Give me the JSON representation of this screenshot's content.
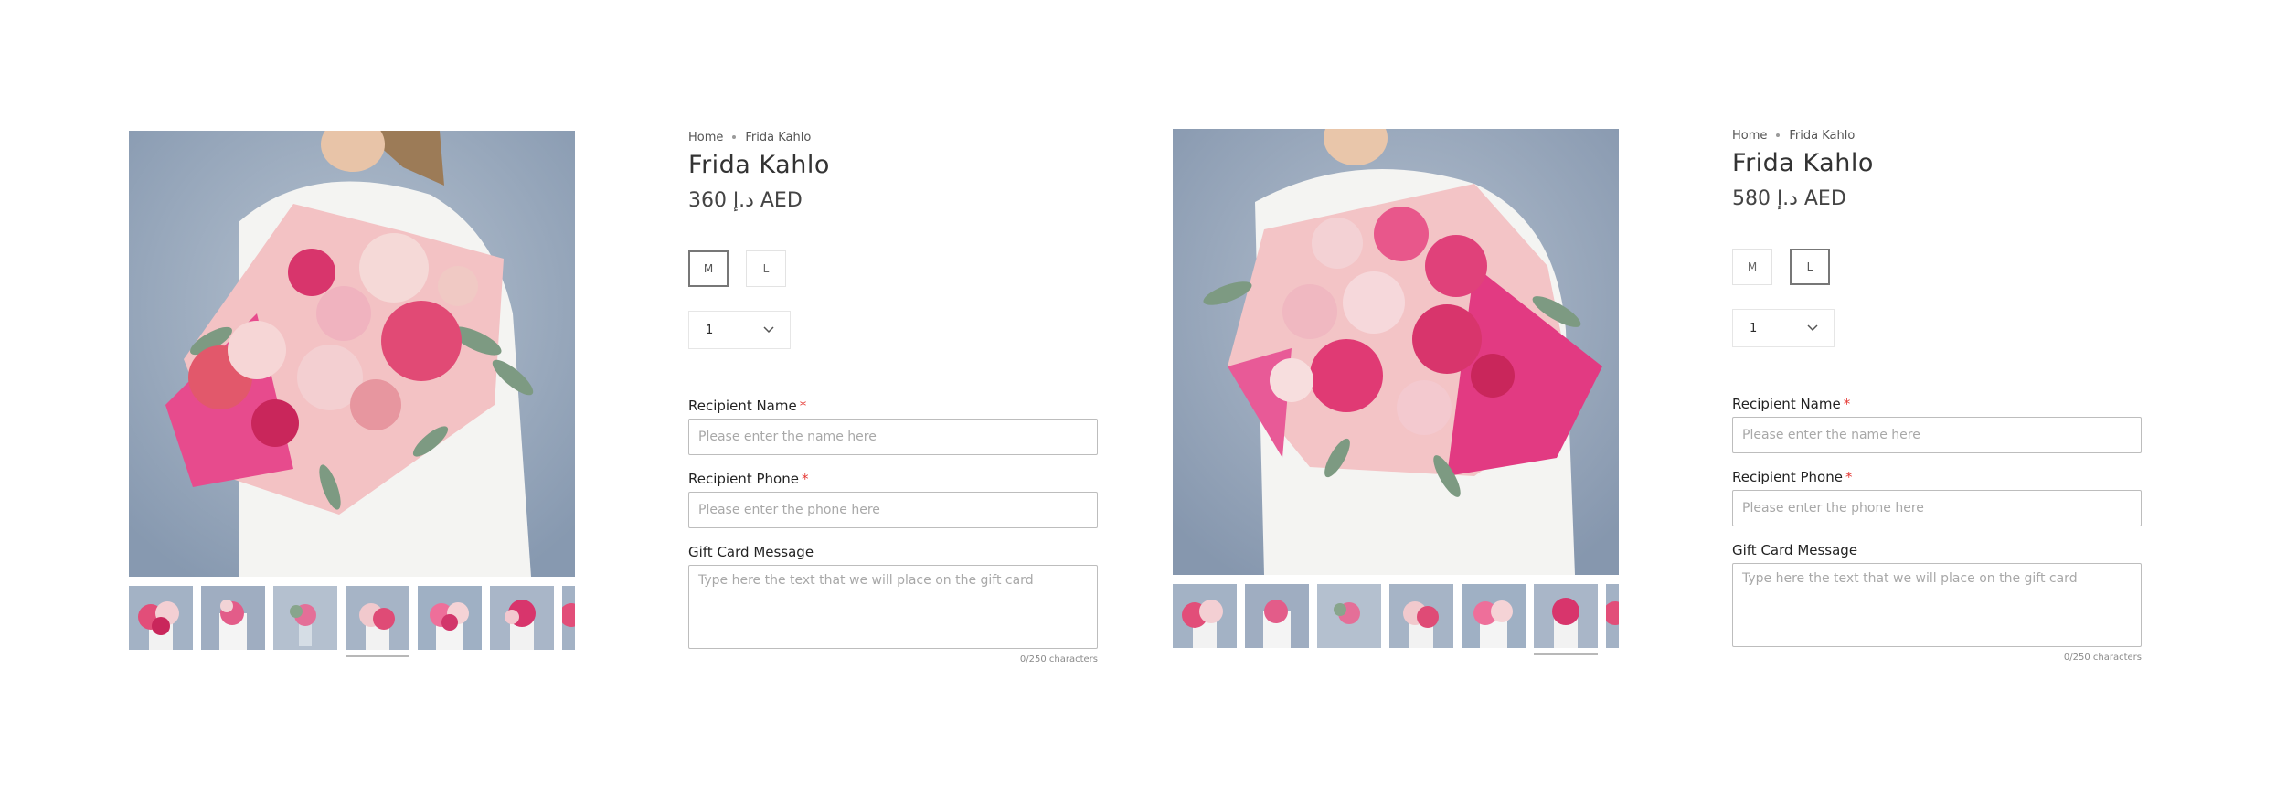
{
  "panels": [
    {
      "breadcrumb": {
        "home": "Home",
        "current": "Frida Kahlo"
      },
      "title": "Frida Kahlo",
      "price": "360 د.إ AED",
      "sizes": [
        {
          "label": "M",
          "selected": true
        },
        {
          "label": "L",
          "selected": false
        }
      ],
      "quantity": "1",
      "thumbnail_count": 7,
      "active_thumbnail": 4
    },
    {
      "breadcrumb": {
        "home": "Home",
        "current": "Frida Kahlo"
      },
      "title": "Frida Kahlo",
      "price": "580 د.إ AED",
      "sizes": [
        {
          "label": "M",
          "selected": false
        },
        {
          "label": "L",
          "selected": true
        }
      ],
      "quantity": "1",
      "thumbnail_count": 7,
      "active_thumbnail": 6
    }
  ],
  "form": {
    "recipient_name_label": "Recipient Name",
    "recipient_name_placeholder": "Please enter the name here",
    "recipient_phone_label": "Recipient Phone",
    "recipient_phone_placeholder": "Please enter the phone here",
    "gift_message_label": "Gift Card Message",
    "gift_message_placeholder": "Type here the text that we will place on the gift card",
    "required_mark": "*",
    "char_counter": "0/250 characters"
  },
  "icons": {
    "quantity_dropdown": "chevron-down-icon",
    "breadcrumb_separator": "dot-icon"
  },
  "colors": {
    "required": "#e53935",
    "border": "#bdbdbd",
    "flower_pink": "#e0407a"
  }
}
